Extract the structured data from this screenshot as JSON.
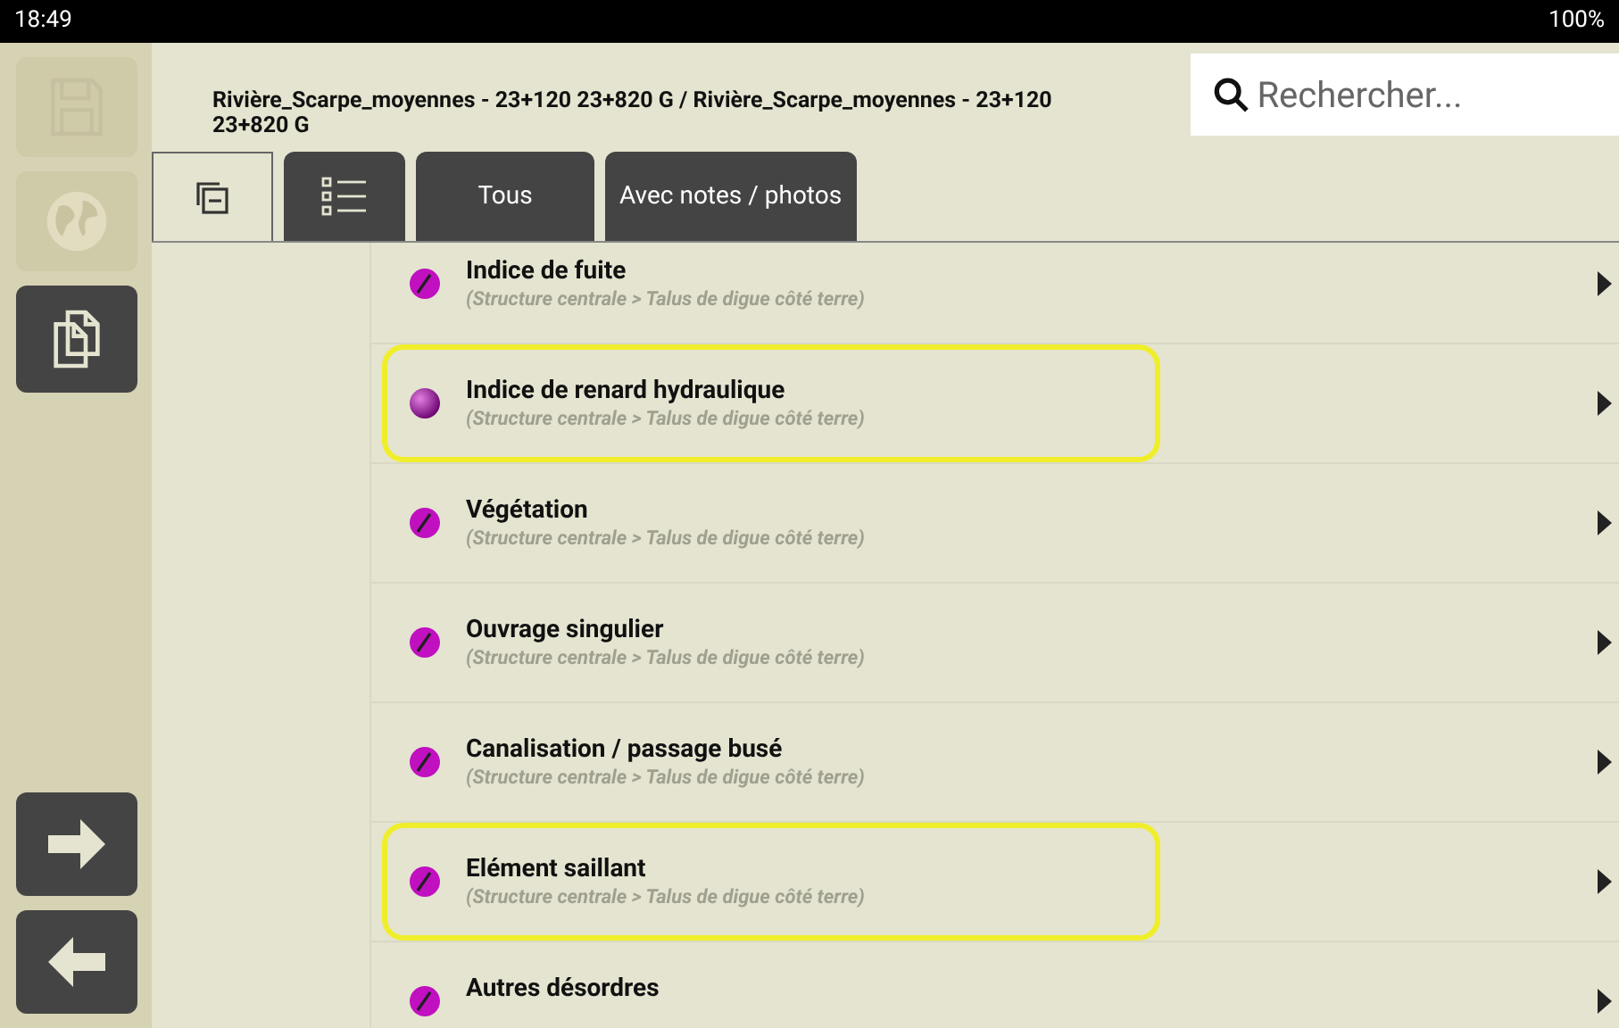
{
  "status_bar": {
    "time": "18:49",
    "battery": "100%"
  },
  "sidebar": {
    "buttons": [
      {
        "kind": "save",
        "disabled": true
      },
      {
        "kind": "globe",
        "disabled": true
      },
      {
        "kind": "copy",
        "disabled": false
      }
    ],
    "nav": [
      {
        "kind": "next"
      },
      {
        "kind": "back"
      }
    ]
  },
  "header": {
    "title": "Rivière_Scarpe_moyennes - 23+120 23+820 G / Rivière_Scarpe_moyennes - 23+120 23+820 G",
    "search": {
      "placeholder": "Rechercher..."
    }
  },
  "toolbar": [
    {
      "kind": "collapse",
      "selected": true
    },
    {
      "kind": "list",
      "selected": false
    },
    {
      "kind": "text",
      "label": "Tous",
      "selected": false
    },
    {
      "kind": "text",
      "label": "Avec notes / photos",
      "selected": false
    }
  ],
  "items": [
    {
      "title": "Indice de fuite",
      "path": "(Structure centrale > Talus de digue côté terre)",
      "kind": "marked",
      "highlighted": false
    },
    {
      "title": "Indice de renard hydraulique",
      "path": "(Structure centrale > Talus de digue côté terre)",
      "kind": "plain",
      "highlighted": true
    },
    {
      "title": "Végétation",
      "path": "(Structure centrale > Talus de digue côté terre)",
      "kind": "marked",
      "highlighted": false
    },
    {
      "title": "Ouvrage singulier",
      "path": "(Structure centrale > Talus de digue côté terre)",
      "kind": "marked",
      "highlighted": false
    },
    {
      "title": "Canalisation / passage busé",
      "path": "(Structure centrale > Talus de digue côté terre)",
      "kind": "marked",
      "highlighted": false
    },
    {
      "title": "Elément saillant",
      "path": "(Structure centrale > Talus de digue côté terre)",
      "kind": "marked",
      "highlighted": true
    },
    {
      "title": "Autres désordres",
      "kind": "marked",
      "highlighted": false
    }
  ]
}
